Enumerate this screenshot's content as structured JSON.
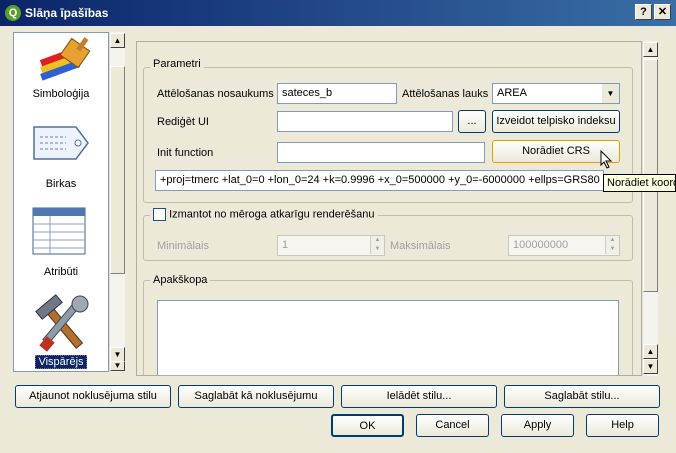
{
  "window": {
    "title": "Slāņa īpašības",
    "help_glyph": "?",
    "close_glyph": "✕"
  },
  "sidebar": {
    "items": [
      {
        "label": "Simboloģija",
        "icon": "paintbrush-icon"
      },
      {
        "label": "Birkas",
        "icon": "tag-icon"
      },
      {
        "label": "Atribūti",
        "icon": "table-icon"
      },
      {
        "label": "Vispārējs",
        "icon": "tools-icon"
      }
    ]
  },
  "params": {
    "group_title": "Parametri",
    "display_name_label": "Attēlošanas nosaukums",
    "display_name_value": "sateces_b",
    "display_field_label": "Attēlošanas lauks",
    "display_field_value": "AREA",
    "edit_ui_label": "Rediģēt UI",
    "edit_ui_value": "",
    "browse_label": "...",
    "spatial_index_label": "Izveidot telpisko indeksu",
    "init_function_label": "Init function",
    "init_function_value": "",
    "specify_crs_label": "Norādiet CRS",
    "crs_string": "+proj=tmerc +lat_0=0 +lon_0=24 +k=0.9996 +x_0=500000 +y_0=-6000000 +ellps=GRS80",
    "tooltip": "Norādiet koordinātu atskaites sistēmu"
  },
  "scale": {
    "checkbox_label": "Izmantot no mēroga atkarīgu renderēšanu",
    "checked": false,
    "min_label": "Minimālais",
    "min_value": "1",
    "max_label": "Maksimālais",
    "max_value": "100000000"
  },
  "subset": {
    "group_title": "Apakškopa"
  },
  "style_buttons": {
    "restore": "Atjaunot noklusējuma stilu",
    "save_default": "Saglabāt kā noklusējumu",
    "load": "Ielādēt stilu...",
    "save": "Saglabāt stilu..."
  },
  "dialog_buttons": {
    "ok": "OK",
    "cancel": "Cancel",
    "apply": "Apply",
    "help": "Help"
  }
}
